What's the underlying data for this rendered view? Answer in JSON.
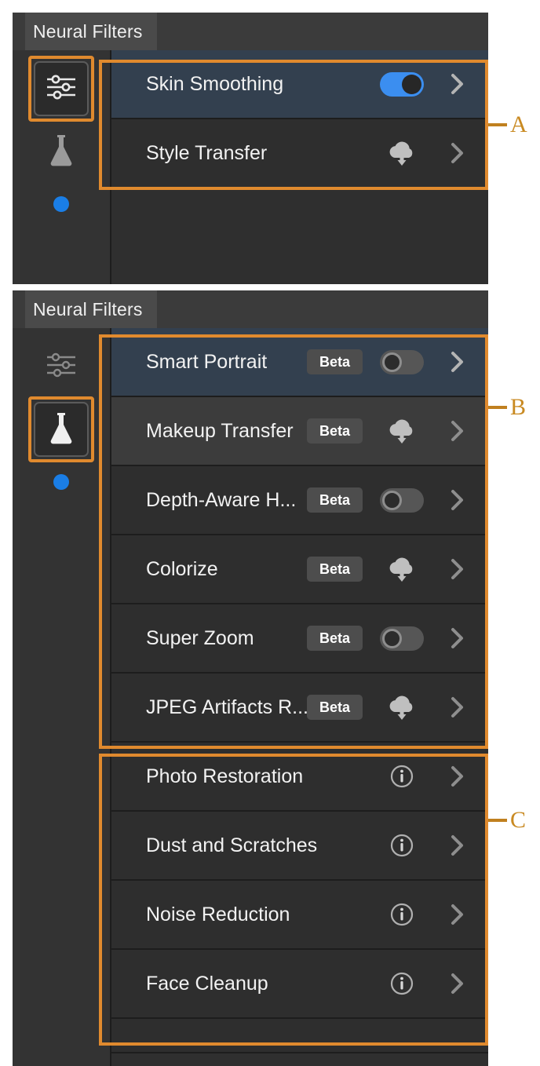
{
  "app": {
    "accent_orange": "#e08a2e",
    "selected_row_blue": "#33404f",
    "toggle_on_blue": "#3b8ef0",
    "dot_blue": "#1a7ee6"
  },
  "panel_a": {
    "title": "Neural Filters",
    "rail": {
      "items": [
        {
          "icon": "sliders-icon",
          "active": true,
          "highlighted": true
        },
        {
          "icon": "flask-icon",
          "active": false,
          "highlighted": false
        }
      ],
      "status_dot": "blue-dot"
    },
    "rows": [
      {
        "label": "Skin Smoothing",
        "badge": null,
        "control": "toggle-on",
        "state": "selected"
      },
      {
        "label": "Style Transfer",
        "badge": null,
        "control": "cloud-download",
        "state": "normal"
      }
    ]
  },
  "panel_b": {
    "title": "Neural Filters",
    "rail": {
      "items": [
        {
          "icon": "sliders-icon",
          "active": false,
          "highlighted": false
        },
        {
          "icon": "flask-icon",
          "active": true,
          "highlighted": true
        }
      ],
      "status_dot": "blue-dot"
    },
    "rows_beta": [
      {
        "label": "Smart Portrait",
        "badge": "Beta",
        "control": "toggle-off",
        "state": "selected"
      },
      {
        "label": "Makeup Transfer",
        "badge": "Beta",
        "control": "cloud-download",
        "state": "hover"
      },
      {
        "label": "Depth-Aware H...",
        "badge": "Beta",
        "control": "toggle-off",
        "state": "normal"
      },
      {
        "label": "Colorize",
        "badge": "Beta",
        "control": "cloud-download",
        "state": "normal"
      },
      {
        "label": "Super Zoom",
        "badge": "Beta",
        "control": "toggle-off",
        "state": "normal"
      },
      {
        "label": "JPEG Artifacts R...",
        "badge": "Beta",
        "control": "cloud-download",
        "state": "normal"
      }
    ],
    "rows_waitlist": [
      {
        "label": "Photo Restoration",
        "badge": null,
        "control": "info",
        "state": "normal"
      },
      {
        "label": "Dust and Scratches",
        "badge": null,
        "control": "info",
        "state": "normal"
      },
      {
        "label": "Noise Reduction",
        "badge": null,
        "control": "info",
        "state": "normal"
      },
      {
        "label": "Face Cleanup",
        "badge": null,
        "control": "info",
        "state": "normal"
      },
      {
        "label": "",
        "badge": null,
        "control": "none",
        "state": "partial"
      }
    ]
  },
  "annotations": [
    {
      "letter": "A"
    },
    {
      "letter": "B"
    },
    {
      "letter": "C"
    }
  ]
}
